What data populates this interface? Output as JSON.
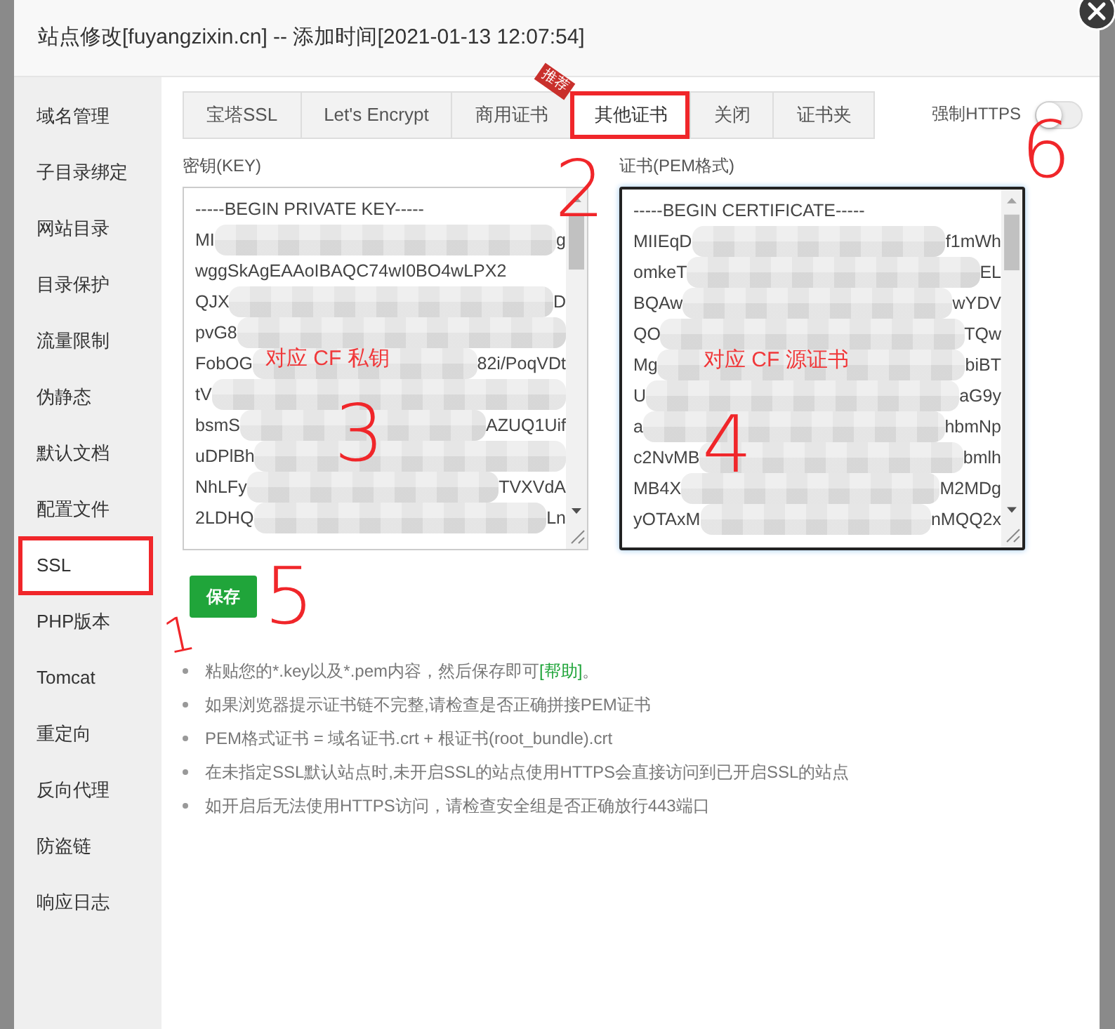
{
  "window": {
    "title": "站点修改[fuyangzixin.cn] -- 添加时间[2021-01-13 12:07:54]"
  },
  "sidebar": {
    "items": [
      {
        "label": "域名管理",
        "selected": false,
        "annotated": false
      },
      {
        "label": "子目录绑定",
        "selected": false,
        "annotated": false
      },
      {
        "label": "网站目录",
        "selected": false,
        "annotated": false
      },
      {
        "label": "目录保护",
        "selected": false,
        "annotated": false
      },
      {
        "label": "流量限制",
        "selected": false,
        "annotated": false
      },
      {
        "label": "伪静态",
        "selected": false,
        "annotated": false
      },
      {
        "label": "默认文档",
        "selected": false,
        "annotated": false
      },
      {
        "label": "配置文件",
        "selected": false,
        "annotated": false
      },
      {
        "label": "SSL",
        "selected": true,
        "annotated": true
      },
      {
        "label": "PHP版本",
        "selected": false,
        "annotated": false
      },
      {
        "label": "Tomcat",
        "selected": false,
        "annotated": false
      },
      {
        "label": "重定向",
        "selected": false,
        "annotated": false
      },
      {
        "label": "反向代理",
        "selected": false,
        "annotated": false
      },
      {
        "label": "防盗链",
        "selected": false,
        "annotated": false
      },
      {
        "label": "响应日志",
        "selected": false,
        "annotated": false
      }
    ]
  },
  "tabs": [
    {
      "label": "宝塔SSL",
      "selected": false,
      "annotated": false
    },
    {
      "label": "Let's Encrypt",
      "selected": false,
      "annotated": false
    },
    {
      "label": "商用证书",
      "selected": false,
      "annotated": false,
      "badge": "推荐"
    },
    {
      "label": "其他证书",
      "selected": true,
      "annotated": true
    },
    {
      "label": "关闭",
      "selected": false,
      "annotated": false
    },
    {
      "label": "证书夹",
      "selected": false,
      "annotated": false
    }
  ],
  "force_https": {
    "label": "强制HTTPS",
    "on": false
  },
  "fields": [
    {
      "label": "密钥(KEY)",
      "focused": false,
      "note": "对应 CF 私钥",
      "lines": [
        {
          "start": "-----BEGIN PRIVATE KEY-----"
        },
        {
          "start": "MI",
          "end": "g"
        },
        {
          "start": "wggSkAgEAAoIBAQC74wI0BO4wLPX2"
        },
        {
          "start": "QJX",
          "end": "D"
        },
        {
          "start": "pvG8"
        },
        {
          "start": "FobOG",
          "end": "82i/PoqVDt"
        },
        {
          "start": "tV"
        },
        {
          "start": "bsmS",
          "end": "AZUQ1Uif"
        },
        {
          "start": "uDPlBh"
        },
        {
          "start": "NhLFy",
          "end": "TVXVdA"
        },
        {
          "start": "2LDHQ",
          "end": "Ln"
        }
      ]
    },
    {
      "label": "证书(PEM格式)",
      "focused": true,
      "note": "对应 CF 源证书",
      "lines": [
        {
          "start": "-----BEGIN CERTIFICATE-----"
        },
        {
          "start": "MIIEqD",
          "end": "f1mWh"
        },
        {
          "start": "omkeT",
          "end": "EL"
        },
        {
          "start": "BQAw",
          "end": "wYDV"
        },
        {
          "start": "QO",
          "end": "TQw"
        },
        {
          "start": "Mg",
          "end": "biBT"
        },
        {
          "start": "U",
          "end": "aG9y"
        },
        {
          "start": "a",
          "end": "hbmNp"
        },
        {
          "start": "c2NvMB",
          "end": "bmlh"
        },
        {
          "start": "MB4X",
          "end": "M2MDg"
        },
        {
          "start": "yOTAxM",
          "end": "nMQQ2x"
        }
      ]
    }
  ],
  "save_button": "保存",
  "notes": [
    {
      "text": "粘贴您的*.key以及*.pem内容，然后保存即可",
      "link": "[帮助]",
      "after": "。"
    },
    {
      "text": "如果浏览器提示证书链不完整,请检查是否正确拼接PEM证书"
    },
    {
      "text": "PEM格式证书 = 域名证书.crt + 根证书(root_bundle).crt"
    },
    {
      "text": "在未指定SSL默认站点时,未开启SSL的站点使用HTTPS会直接访问到已开启SSL的站点"
    },
    {
      "text": "如开启后无法使用HTTPS访问，请检查安全组是否正确放行443端口"
    }
  ],
  "annotations": [
    {
      "text": "1"
    },
    {
      "text": "2"
    },
    {
      "text": "3"
    },
    {
      "text": "4"
    },
    {
      "text": "5"
    },
    {
      "text": "6"
    }
  ]
}
